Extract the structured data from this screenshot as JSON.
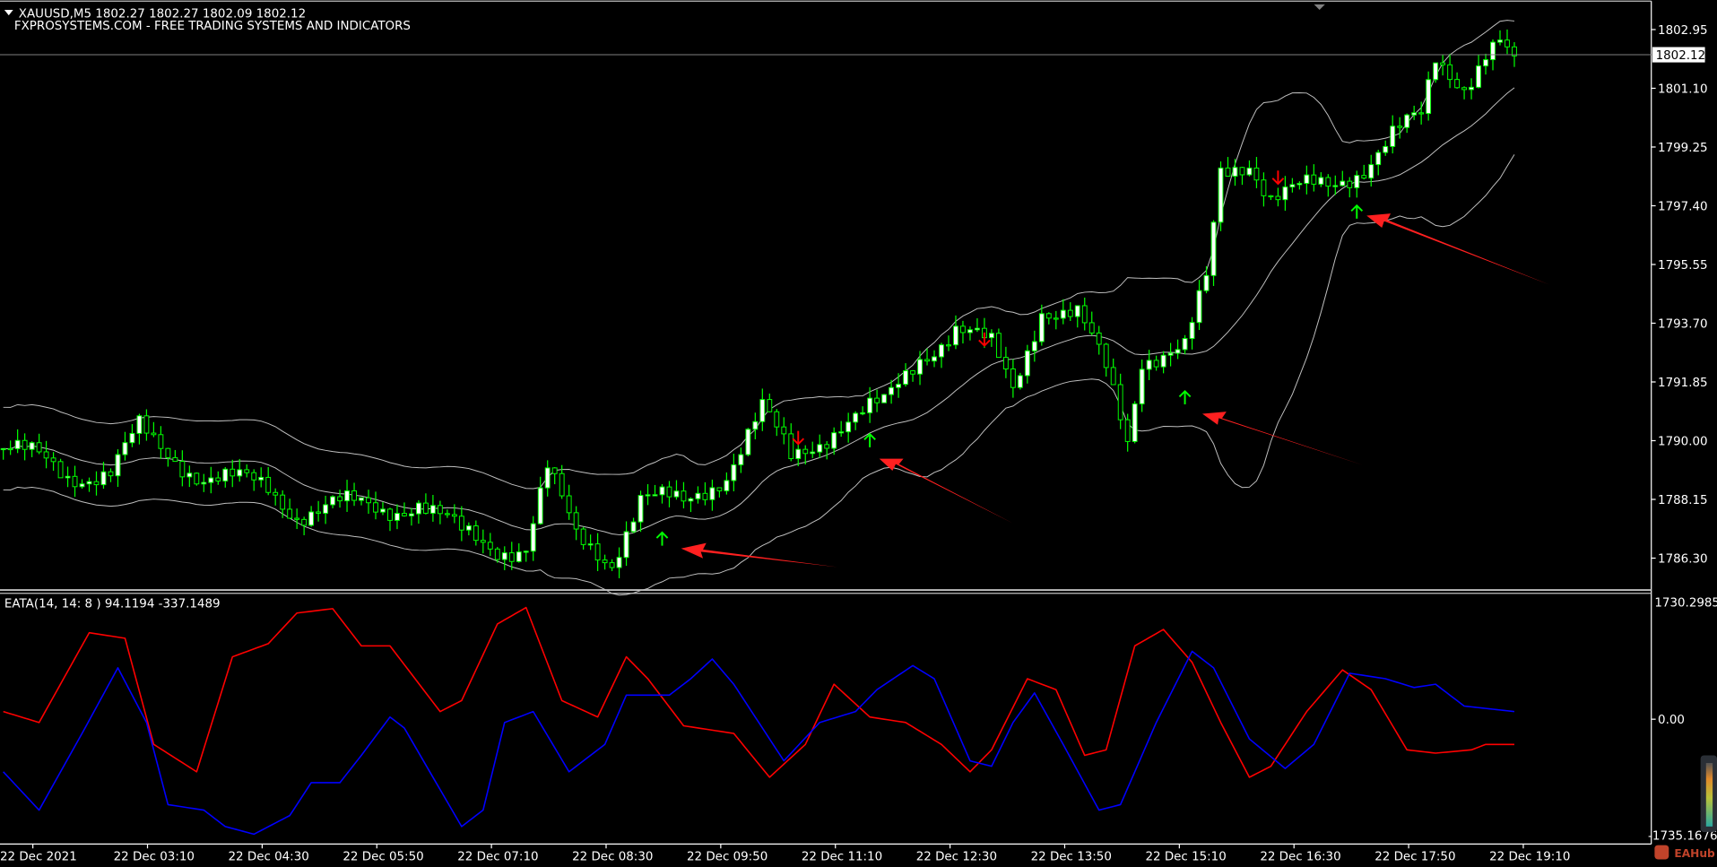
{
  "header": {
    "symbol_line": "XAUUSD,M5  1802.27 1802.27 1802.09 1802.12",
    "subtitle": "FXPROSYSTEMS.COM - FREE TRADING SYSTEMS AND INDICATORS"
  },
  "price_axis": {
    "ticks": [
      "1802.95",
      "1801.10",
      "1799.25",
      "1797.40",
      "1795.55",
      "1793.70",
      "1791.85",
      "1790.00",
      "1788.15",
      "1786.30"
    ],
    "current_price": "1802.12"
  },
  "indicator": {
    "label": "EATA(14, 14: 8 ) 94.1194 -337.1489",
    "axis_max": "1730.2985",
    "axis_zero": "0.00",
    "axis_min": "-1735.1676"
  },
  "time_axis": [
    "22 Dec 2021",
    "22 Dec 03:10",
    "22 Dec 04:30",
    "22 Dec 05:50",
    "22 Dec 07:10",
    "22 Dec 08:30",
    "22 Dec 09:50",
    "22 Dec 11:10",
    "22 Dec 12:30",
    "22 Dec 13:50",
    "22 Dec 15:10",
    "22 Dec 16:30",
    "22 Dec 17:50",
    "22 Dec 19:10"
  ],
  "watermark": "EAHub",
  "colors": {
    "bull": "#ffffff",
    "candle_line": "#00ff00",
    "band": "#c0c0c0",
    "fast": "#ff0000",
    "slow": "#0000ff",
    "buy_arrow": "#00ff00",
    "sell_arrow": "#ff0000",
    "annotation": "#ff2020"
  },
  "chart_data": {
    "type": "candlestick",
    "symbol": "XAUUSD",
    "timeframe": "M5",
    "ylim": [
      1785.5,
      1803.8
    ],
    "close_path": [
      [
        0,
        1789.75
      ],
      [
        5,
        1789.4
      ],
      [
        9,
        1788.95
      ],
      [
        15,
        1789.0
      ],
      [
        19,
        1790.3
      ],
      [
        21,
        1789.9
      ],
      [
        28,
        1788.9
      ],
      [
        37,
        1788.5
      ],
      [
        41,
        1787.75
      ],
      [
        46,
        1787.95
      ],
      [
        53,
        1787.85
      ],
      [
        58,
        1788.1
      ],
      [
        64,
        1787.0
      ],
      [
        69,
        1786.65
      ],
      [
        73,
        1786.7
      ],
      [
        76,
        1789.05
      ],
      [
        80,
        1786.9
      ],
      [
        85,
        1786.3
      ],
      [
        89,
        1788.2
      ],
      [
        95,
        1787.95
      ],
      [
        101,
        1789.05
      ],
      [
        106,
        1790.95
      ],
      [
        110,
        1789.4
      ],
      [
        117,
        1790.6
      ],
      [
        123,
        1791.05
      ],
      [
        128,
        1792.7
      ],
      [
        133,
        1793.55
      ],
      [
        138,
        1792.9
      ],
      [
        141,
        1791.65
      ],
      [
        145,
        1794.25
      ],
      [
        150,
        1793.9
      ],
      [
        154,
        1792.2
      ],
      [
        157,
        1790.1
      ],
      [
        159,
        1792.7
      ],
      [
        165,
        1792.85
      ],
      [
        168,
        1794.95
      ],
      [
        170,
        1798.4
      ],
      [
        174,
        1798.9
      ],
      [
        177,
        1797.7
      ],
      [
        181,
        1797.85
      ],
      [
        185,
        1798.0
      ],
      [
        190,
        1798.7
      ],
      [
        194,
        1799.6
      ],
      [
        198,
        1800.1
      ],
      [
        200,
        1802.0
      ],
      [
        204,
        1801.3
      ],
      [
        208,
        1802.5
      ],
      [
        211,
        1802.12
      ]
    ],
    "buy_signals": [
      [
        92,
        1786.9
      ],
      [
        121,
        1790.0
      ],
      [
        165,
        1791.35
      ],
      [
        189,
        1797.2
      ]
    ],
    "sell_signals": [
      [
        111,
        1790.1
      ],
      [
        137,
        1793.2
      ],
      [
        178,
        1798.3
      ]
    ],
    "indicator": {
      "name": "EATA(14, 14: 8 )",
      "ylim": [
        -1735.1676,
        1730.2985
      ],
      "series": [
        {
          "name": "fast",
          "color": "#ff0000",
          "points": [
            [
              0,
              114
            ],
            [
              5,
              -49
            ],
            [
              12,
              1290
            ],
            [
              17,
              1208
            ],
            [
              21,
              -375
            ],
            [
              27,
              -784
            ],
            [
              32,
              931
            ],
            [
              37,
              1127
            ],
            [
              41,
              1584
            ],
            [
              46,
              1649
            ],
            [
              50,
              1094
            ],
            [
              54,
              1094
            ],
            [
              61,
              114
            ],
            [
              64,
              278
            ],
            [
              69,
              1421
            ],
            [
              73,
              1666
            ],
            [
              78,
              278
            ],
            [
              83,
              33
            ],
            [
              87,
              931
            ],
            [
              90,
              604
            ],
            [
              95,
              -98
            ],
            [
              102,
              -212
            ],
            [
              107,
              -866
            ],
            [
              112,
              -376
            ],
            [
              116,
              522
            ],
            [
              121,
              33
            ],
            [
              126,
              -49
            ],
            [
              131,
              -376
            ],
            [
              135,
              -784
            ],
            [
              138,
              -457
            ],
            [
              143,
              604
            ],
            [
              147,
              441
            ],
            [
              151,
              -539
            ],
            [
              154,
              -457
            ],
            [
              158,
              1094
            ],
            [
              162,
              1339
            ],
            [
              166,
              849
            ],
            [
              170,
              -49
            ],
            [
              174,
              -866
            ],
            [
              177,
              -702
            ],
            [
              182,
              114
            ],
            [
              187,
              735
            ],
            [
              191,
              441
            ],
            [
              196,
              -457
            ],
            [
              200,
              -506
            ],
            [
              205,
              -457
            ],
            [
              207,
              -376
            ],
            [
              211,
              -376
            ]
          ]
        },
        {
          "name": "slow",
          "color": "#0000ff",
          "points": [
            [
              0,
              -784
            ],
            [
              5,
              -1356
            ],
            [
              11,
              -212
            ],
            [
              16,
              767
            ],
            [
              20,
              -49
            ],
            [
              23,
              -1274
            ],
            [
              28,
              -1356
            ],
            [
              31,
              -1601
            ],
            [
              35,
              -1715
            ],
            [
              40,
              -1437
            ],
            [
              43,
              -947
            ],
            [
              47,
              -947
            ],
            [
              50,
              -539
            ],
            [
              54,
              33
            ],
            [
              56,
              -131
            ],
            [
              60,
              -866
            ],
            [
              64,
              -1601
            ],
            [
              67,
              -1356
            ],
            [
              70,
              -49
            ],
            [
              74,
              114
            ],
            [
              79,
              -784
            ],
            [
              84,
              -376
            ],
            [
              87,
              359
            ],
            [
              93,
              359
            ],
            [
              96,
              604
            ],
            [
              99,
              898
            ],
            [
              102,
              522
            ],
            [
              106,
              -131
            ],
            [
              109,
              -621
            ],
            [
              114,
              -49
            ],
            [
              119,
              114
            ],
            [
              122,
              441
            ],
            [
              127,
              800
            ],
            [
              130,
              604
            ],
            [
              135,
              -621
            ],
            [
              138,
              -702
            ],
            [
              141,
              -49
            ],
            [
              144,
              392
            ],
            [
              148,
              -376
            ],
            [
              153,
              -1356
            ],
            [
              156,
              -1274
            ],
            [
              161,
              -49
            ],
            [
              166,
              1013
            ],
            [
              169,
              767
            ],
            [
              174,
              -294
            ],
            [
              179,
              -735
            ],
            [
              183,
              -376
            ],
            [
              188,
              686
            ],
            [
              193,
              604
            ],
            [
              197,
              473
            ],
            [
              200,
              522
            ],
            [
              204,
              196
            ],
            [
              211,
              114
            ]
          ]
        }
      ]
    }
  }
}
